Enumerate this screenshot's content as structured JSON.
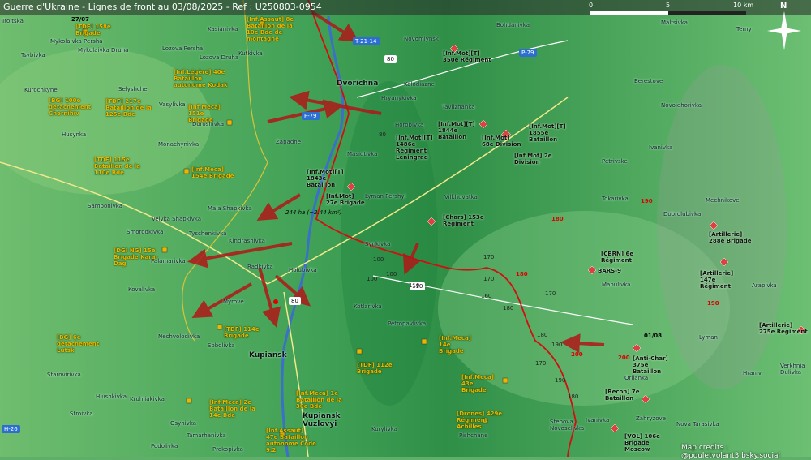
{
  "title": "Guerre d'Ukraine - Lignes de front au 03/08/2025 - Ref : U250803-0954",
  "scale": {
    "labels": [
      "0",
      "5",
      "10 km"
    ]
  },
  "compass_label": "N",
  "credits": "Map credits : @pouletvolant3.bsky.social",
  "area_label": "244 ha (~2.44 km²)",
  "dates": [
    "27/07",
    "01/08"
  ],
  "roads": [
    "T-21-14",
    "P-79",
    "P-79",
    "H-26",
    "80",
    "110",
    "80"
  ],
  "places": [
    "Troitskа",
    "Mykolaivka Persha",
    "Tsybivka",
    "Mykolaivka Druha",
    "Kurochkyne",
    "Husynka",
    "Kasianivka",
    "Lozova Persha",
    "Lozova Druha",
    "Kutkivka",
    "Selyshche",
    "Vasylivka",
    "Doroshivka",
    "Monachynivka",
    "Zapadne",
    "Dvorichna",
    "Novomlynsk",
    "Bohdanivka",
    "Maltsivka",
    "Terny",
    "Berestove",
    "Novoiehorivka",
    "Kolodiazne",
    "Tavilzhanka",
    "Hryanykivka",
    "Horobivka",
    "Masiutivka",
    "Lyman Pershyi",
    "Vilkhuvatka",
    "Tokarivka",
    "Petrivske",
    "Ivanivka",
    "Mechnikove",
    "Dobrolubivka",
    "Kindrashivka",
    "Petropavlivka",
    "Synkivka",
    "Radkivka",
    "Holubivka",
    "Myrove",
    "Kovalivka",
    "Nechvolodivka",
    "Sobolivka",
    "Kupiansk",
    "Kupiansk Vuzlovyi",
    "Stepova Novoselivka",
    "Ivanivka",
    "Orlianka",
    "Zahryzove",
    "Nova Tarasivka",
    "Pishchane",
    "Kurylivka",
    "Tamarhanivka",
    "Prokopivka",
    "Podolivka",
    "Osynivka",
    "Kruhliakivka",
    "Hlushkivka",
    "Stroivka",
    "Starovirivka",
    "Sambonivka",
    "Velyka Shapkivka",
    "Mala Shapkivka",
    "Smorodkivka",
    "Tyschenkivka",
    "Palamarivka",
    "Kotlarivka",
    "Hraniv",
    "Arapivka",
    "Verkhnia Dulivka",
    "Manulivka",
    "Lyman"
  ],
  "ua_units": [
    {
      "text": "[TDF] 158e Brigade"
    },
    {
      "text": "[Inf.Assaut] 8e Bataillon de la 10e Bde de montagne"
    },
    {
      "text": "[Inf.Légère] 40e Bataillon autonome Kodak"
    },
    {
      "text": "[BG] 100e détachement Chernihiv"
    },
    {
      "text": "[TDF] 217e Bataillon de la 125e Bde"
    },
    {
      "text": "[Inf.Meca] 151e Brigade"
    },
    {
      "text": "[TDF] 115e Bataillon de la 110e Bde"
    },
    {
      "text": "[Inf.Meca] 154e Brigade"
    },
    {
      "text": "[DGI NG] 15e Brigade Kara-Dag"
    },
    {
      "text": "[BG] 6e détachement Lutsk"
    },
    {
      "text": "[TDF] 114e Brigade"
    },
    {
      "text": "[TDF] 112e Brigade"
    },
    {
      "text": "[Inf.Meca] 14e Brigade"
    },
    {
      "text": "[Inf.Meca] 43e Brigade"
    },
    {
      "text": "[Inf.Meca] 2e Bataillon de la 14e Bde"
    },
    {
      "text": "[Inf.Meca] 1e Bataillon de la 30e Bde"
    },
    {
      "text": "[Drones] 429e Régiment Achilles"
    },
    {
      "text": "[Inf.Assaut] 47e Bataillon autonome Code 9.2"
    }
  ],
  "ru_units": [
    {
      "text": "[Inf.Mot][T] 350e Régiment"
    },
    {
      "text": "[Inf.Mot][T] 1844e Bataillon"
    },
    {
      "text": "[Inf.Mot][T] 1855e Bataillon"
    },
    {
      "text": "[Inf.Mot][T] 1486e Régiment Leningrad"
    },
    {
      "text": "[Inf.Mot] 68e Division"
    },
    {
      "text": "[Inf.Mot] 2e Division"
    },
    {
      "text": "[Inf.Mot][T] 1843e Bataillon"
    },
    {
      "text": "[Inf.Mot] 27e Brigade"
    },
    {
      "text": "[Chars] 153e Régiment"
    },
    {
      "text": "[Artillerie] 288e Brigade"
    },
    {
      "text": "[CBRN] 6e Régiment"
    },
    {
      "text": "BARS-9"
    },
    {
      "text": "[Artillerie] 147e Régiment"
    },
    {
      "text": "[Artillerie] 275e Régiment"
    },
    {
      "text": "[Anti-Char] 375e Bataillon"
    },
    {
      "text": "[Recon] 7e Bataillon"
    },
    {
      "text": "[VOL] 106e Brigade Moscow"
    }
  ],
  "elevations": [
    "80",
    "110",
    "170",
    "170",
    "160",
    "180",
    "100",
    "100",
    "100",
    "180",
    "190",
    "190",
    "180",
    "200",
    "200",
    "170",
    "180",
    "170",
    "190",
    "180",
    "190"
  ],
  "colors": {
    "ua_label": "#e8b800",
    "front_line": "#d01010",
    "arrow": "#b01818",
    "road": "#2d6fd0",
    "terrain": "#5fae6a"
  }
}
